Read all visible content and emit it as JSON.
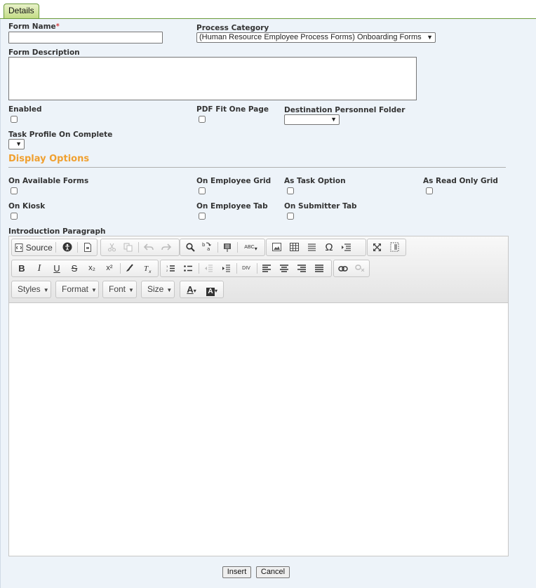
{
  "tabs": {
    "details": "Details"
  },
  "form": {
    "form_name_label": "Form Name",
    "required_mark": "*",
    "form_name_value": "",
    "process_category_label": "Process Category",
    "process_category_value": "(Human Resource Employee Process Forms) Onboarding Forms",
    "form_description_label": "Form Description",
    "form_description_value": "",
    "enabled_label": "Enabled",
    "pdf_fit_label": "PDF Fit One Page",
    "destination_folder_label": "Destination Personnel Folder",
    "destination_folder_value": "",
    "task_profile_label": "Task Profile On Complete",
    "task_profile_value": ""
  },
  "display_options": {
    "heading": "Display Options",
    "on_available_forms": "On Available Forms",
    "on_employee_grid": "On Employee Grid",
    "as_task_option": "As Task Option",
    "as_read_only_grid": "As Read Only Grid",
    "on_kiosk": "On Kiosk",
    "on_employee_tab": "On Employee Tab",
    "on_submitter_tab": "On Submitter Tab"
  },
  "intro": {
    "label": "Introduction Paragraph"
  },
  "editor": {
    "source_label": "Source",
    "styles_label": "Styles",
    "format_label": "Format",
    "font_label": "Font",
    "size_label": "Size",
    "icons": {
      "bold": "B",
      "italic": "I",
      "underline": "U",
      "strike": "S",
      "subscript": "x₂",
      "superscript": "x²",
      "omega": "Ω",
      "text_color": "A",
      "bg_color": "A",
      "spellcheck": "ABC",
      "div": "DIV"
    }
  },
  "actions": {
    "insert": "Insert",
    "cancel": "Cancel"
  }
}
